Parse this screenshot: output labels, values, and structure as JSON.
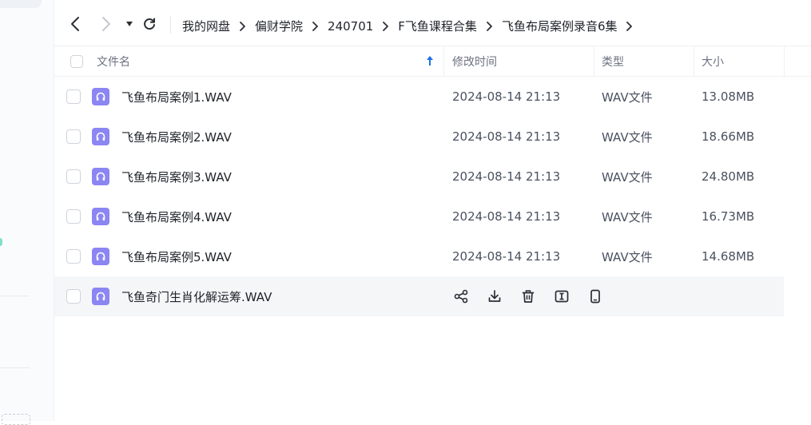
{
  "toolbar": {
    "back_icon": "chevron-left-icon",
    "forward_icon": "chevron-right-icon",
    "dropdown_icon": "caret-down-icon",
    "refresh_icon": "refresh-icon",
    "breadcrumbs": [
      "我的网盘",
      "偏财学院",
      "240701",
      "F飞鱼课程合集",
      "飞鱼布局案例录音6集"
    ]
  },
  "table": {
    "headers": {
      "name": "文件名",
      "modified": "修改时间",
      "type": "类型",
      "size": "大小"
    },
    "sort_icon": "sort-ascending-arrow-icon",
    "rows": [
      {
        "name": "飞鱼布局案例1.WAV",
        "modified": "2024-08-14 21:13",
        "type": "WAV文件",
        "size": "13.08MB"
      },
      {
        "name": "飞鱼布局案例2.WAV",
        "modified": "2024-08-14 21:13",
        "type": "WAV文件",
        "size": "18.66MB"
      },
      {
        "name": "飞鱼布局案例3.WAV",
        "modified": "2024-08-14 21:13",
        "type": "WAV文件",
        "size": "24.80MB"
      },
      {
        "name": "飞鱼布局案例4.WAV",
        "modified": "2024-08-14 21:13",
        "type": "WAV文件",
        "size": "16.73MB"
      },
      {
        "name": "飞鱼布局案例5.WAV",
        "modified": "2024-08-14 21:13",
        "type": "WAV文件",
        "size": "14.68MB"
      }
    ],
    "hover_row": {
      "name": "飞鱼奇门生肖化解运筹.WAV",
      "actions": [
        "share-icon",
        "download-icon",
        "delete-icon",
        "rename-icon",
        "phone-icon"
      ]
    }
  },
  "colors": {
    "accent": "#1a73e8",
    "audio_icon": "#8b86f2",
    "hover_bg": "#f5f6f8"
  }
}
